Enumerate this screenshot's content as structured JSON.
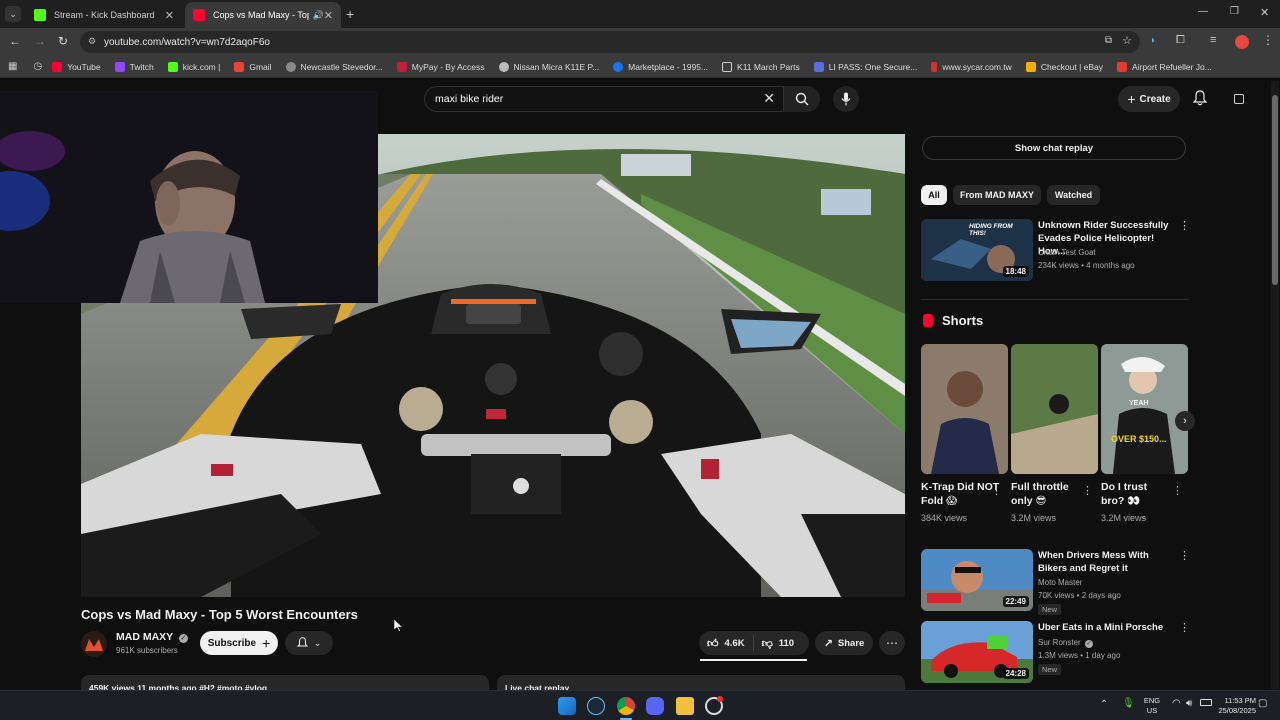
{
  "browser": {
    "tabs": [
      {
        "label": "Stream - Kick Dashboard",
        "active": false
      },
      {
        "label": "Cops vs Mad Maxy - Top 5",
        "active": true
      }
    ],
    "url": "youtube.com/watch?v=wn7d2aqoF6o",
    "bookmarks": [
      "YouTube",
      "Twitch",
      "kick.com |",
      "Gmail",
      "Newcastle Stevedor...",
      "MyPay - By Access",
      "Nissan Micra K11E P...",
      "Marketplace - 1995...",
      "K11 March Parts",
      "LI PASS: One Secure...",
      "www.sycar.com.tw",
      "Checkout | eBay",
      "Airport Refueller Jo..."
    ]
  },
  "youtube": {
    "search_value": "maxi bike rider",
    "create_label": "Create",
    "video_title": "Cops vs Mad Maxy - Top 5 Worst Encounters",
    "channel_name": "MAD MAXY",
    "channel_subs": "961K subscribers",
    "subscribe_label": "Subscribe",
    "likes": "4.6K",
    "dislikes": "110",
    "share_label": "Share",
    "description_preview": "459K views  11 months ago  #H2 #moto #vlog",
    "live_chat_label": "Live chat replay",
    "show_chat_replay": "Show chat replay",
    "chips": [
      "All",
      "From MAD MAXY",
      "Watched"
    ],
    "shorts_heading": "Shorts",
    "recommended": [
      {
        "title": "Unknown Rider Successfully Evades Police Helicopter! How...",
        "channel": "Crash Test Goat",
        "meta": "234K views • 4 months ago",
        "duration": "18:48",
        "thumb_text": "HIDING FROM THIS!"
      },
      {
        "title": "When Drivers Mess With Bikers and Regret it",
        "channel": "Moto Master",
        "meta": "70K views • 2 days ago",
        "duration": "22:49",
        "badge": "New"
      },
      {
        "title": "Uber Eats in a Mini Porsche",
        "channel": "Sur Ronster",
        "meta": "1.3M views • 1 day ago",
        "duration": "24:28",
        "badge": "New"
      }
    ],
    "shorts": [
      {
        "title": "K-Trap Did NOT Fold 😱",
        "views": "384K views"
      },
      {
        "title": "Full throttle only 😎",
        "views": "3.2M views"
      },
      {
        "title": "Do I trust bro? 👀",
        "views": "3.2M views",
        "thumb_text": "YEAH",
        "thumb_text2": "OVER $150..."
      }
    ]
  },
  "taskbar": {
    "lang_top": "ENG",
    "lang_bottom": "US",
    "time": "11:53 PM",
    "date": "25/08/2025"
  }
}
